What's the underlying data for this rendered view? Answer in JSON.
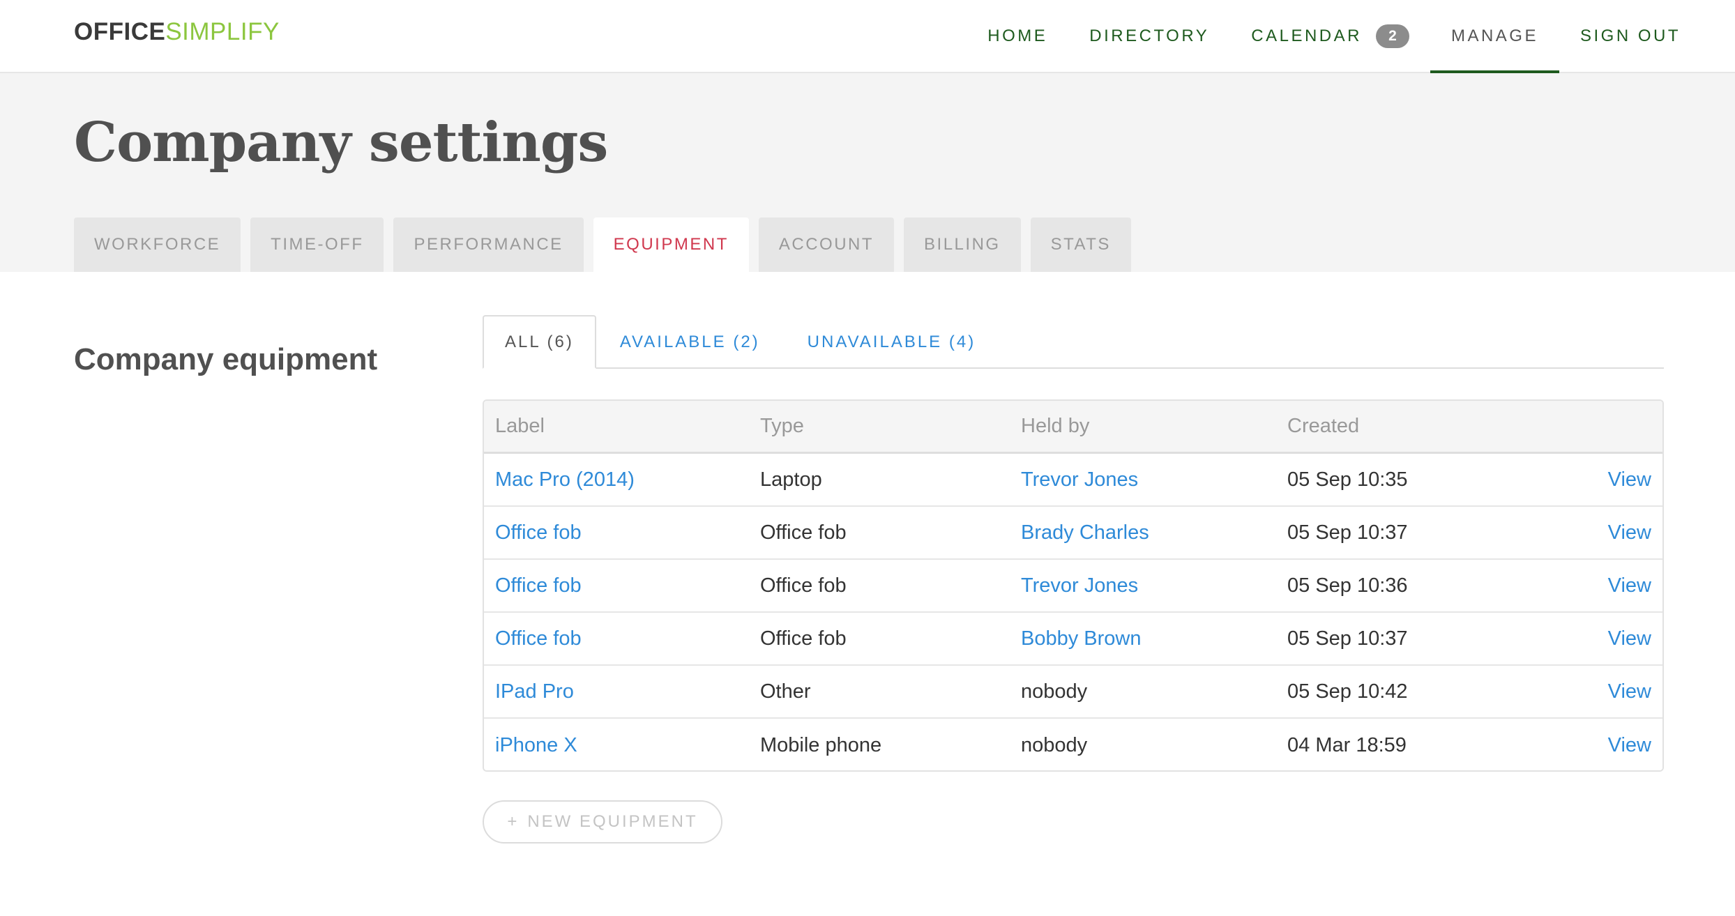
{
  "brand": {
    "part1": "OFFICE",
    "part2": "SIMPLIFY",
    "accent": "#8cc63f"
  },
  "nav": {
    "home": "HOME",
    "directory": "DIRECTORY",
    "calendar": "CALENDAR",
    "calendar_badge": "2",
    "manage": "MANAGE",
    "sign_out": "SIGN OUT",
    "active": "MANAGE"
  },
  "page": {
    "title": "Company settings"
  },
  "settings_tabs": [
    "WORKFORCE",
    "TIME-OFF",
    "PERFORMANCE",
    "EQUIPMENT",
    "ACCOUNT",
    "BILLING",
    "STATS"
  ],
  "settings_tab_active": "EQUIPMENT",
  "section": {
    "title": "Company equipment"
  },
  "filter_tabs": [
    "ALL (6)",
    "AVAILABLE (2)",
    "UNAVAILABLE (4)"
  ],
  "filter_tab_active": "ALL (6)",
  "table": {
    "headers": {
      "label": "Label",
      "type": "Type",
      "held_by": "Held by",
      "created": "Created"
    },
    "rows": [
      {
        "label": "Mac Pro (2014)",
        "type": "Laptop",
        "held_by": "Trevor Jones",
        "created": "05 Sep 10:35",
        "action": "View"
      },
      {
        "label": "Office fob",
        "type": "Office fob",
        "held_by": "Brady Charles",
        "created": "05 Sep 10:37",
        "action": "View"
      },
      {
        "label": "Office fob",
        "type": "Office fob",
        "held_by": "Trevor Jones",
        "created": "05 Sep 10:36",
        "action": "View"
      },
      {
        "label": "Office fob",
        "type": "Office fob",
        "held_by": "Bobby Brown",
        "created": "05 Sep 10:37",
        "action": "View"
      },
      {
        "label": "IPad Pro",
        "type": "Other",
        "held_by": "nobody",
        "created": "05 Sep 10:42",
        "action": "View"
      },
      {
        "label": "iPhone X",
        "type": "Mobile phone",
        "held_by": "nobody",
        "created": "04 Mar 18:59",
        "action": "View"
      }
    ]
  },
  "new_button": {
    "plus": "+",
    "label": "NEW EQUIPMENT"
  },
  "colors": {
    "nav_text": "#1e5a1e",
    "link": "#2e8ad8",
    "active_settings_tab": "#d0384e",
    "badge_bg": "#8c8c8c"
  }
}
